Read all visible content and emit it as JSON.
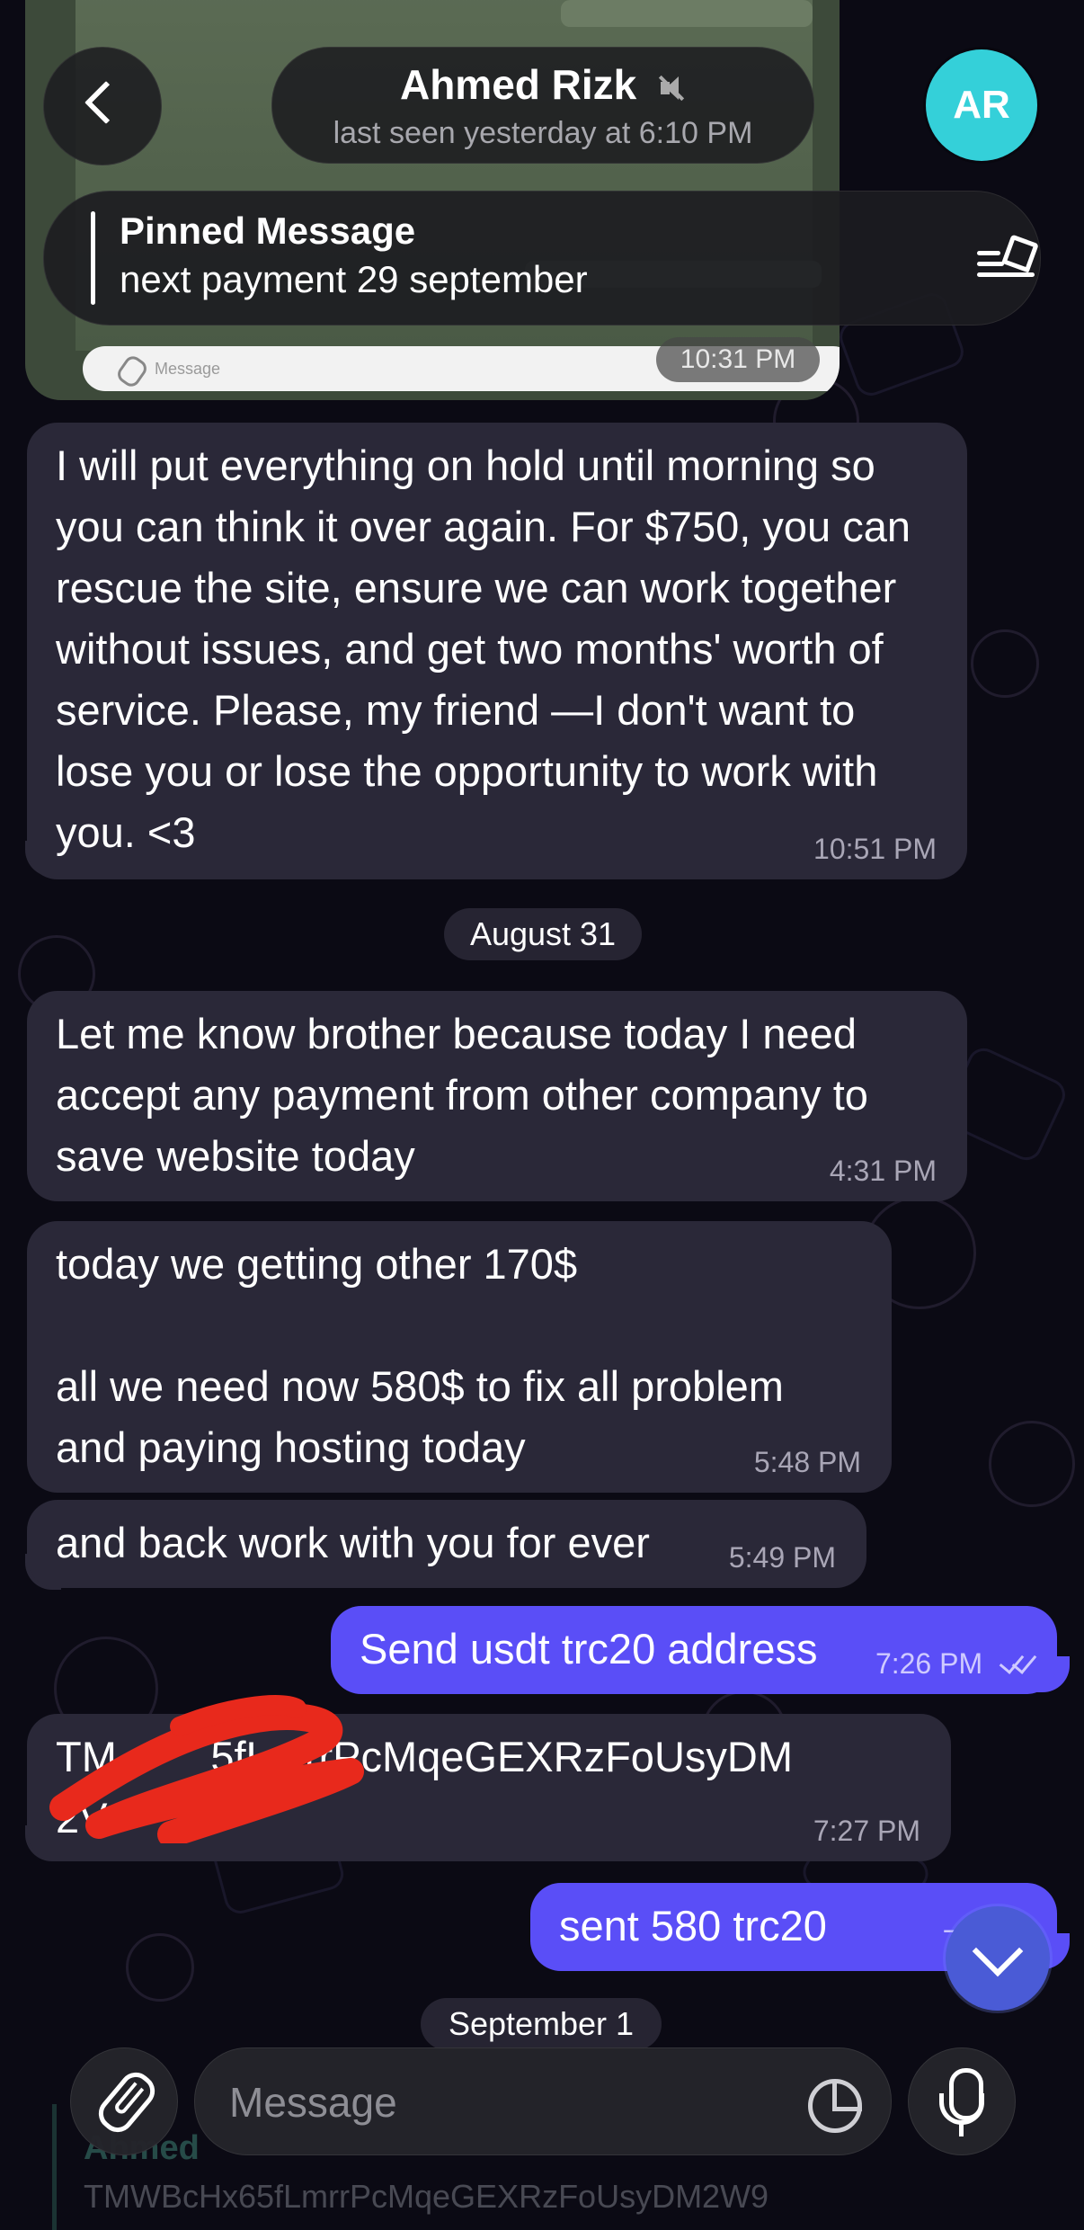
{
  "header": {
    "contact_name": "Ahmed Rizk",
    "last_seen": "last seen yesterday at 6:10 PM",
    "avatar_initials": "AR",
    "avatar_color": "#34d0d9",
    "back_icon": "chevron-left-icon",
    "muted_icon": "muted-speaker-icon"
  },
  "pinned": {
    "title": "Pinned Message",
    "text": "next payment 29 september",
    "icon": "pinned-list-icon"
  },
  "screenshot_bubble": {
    "input_placeholder": "Message",
    "time": "10:31 PM"
  },
  "messages": [
    {
      "direction": "incoming",
      "text": "I will put everything on hold until morning so you can think it over again. For $750, you can rescue the site, ensure we can work together without issues, and get two months' worth of service. Please, my friend —I don't want to lose you or lose the opportunity to work with you. <3",
      "time": "10:51 PM"
    },
    {
      "direction": "incoming",
      "text": "Let me know brother because today I need accept any payment from other company to save website today",
      "time": "4:31 PM"
    },
    {
      "direction": "incoming",
      "text": "today we getting other 170$\n\nall we need now 580$ to fix all problem and paying hosting today",
      "time": "5:48 PM"
    },
    {
      "direction": "incoming",
      "text": "and back work with you for ever",
      "time": "5:49 PM"
    },
    {
      "direction": "outgoing",
      "text": "Send usdt trc20 address",
      "time": "7:26 PM",
      "status": "read"
    },
    {
      "direction": "incoming",
      "text": "TM        5fLmrrPcMqeGEXRzFoUsyDM\n2V",
      "time": "7:27 PM"
    },
    {
      "direction": "outgoing",
      "text": "sent 580 trc20",
      "time": "7:2",
      "status": "read"
    }
  ],
  "date_separators": {
    "aug31": "August 31",
    "sep1": "September 1"
  },
  "reply_preview": {
    "name": "Ahmed",
    "text": "TMWBcHx65fLmrrPcMqeGEXRzFoUsyDM2W9"
  },
  "composer": {
    "placeholder": "Message",
    "attach_icon": "paperclip-icon",
    "sticker_icon": "sticker-icon",
    "mic_icon": "microphone-icon"
  },
  "colors": {
    "background": "#0b0a14",
    "incoming_bubble": "#2a2838",
    "outgoing_bubble": "#5a4ef7",
    "redaction": "#e8291c"
  }
}
